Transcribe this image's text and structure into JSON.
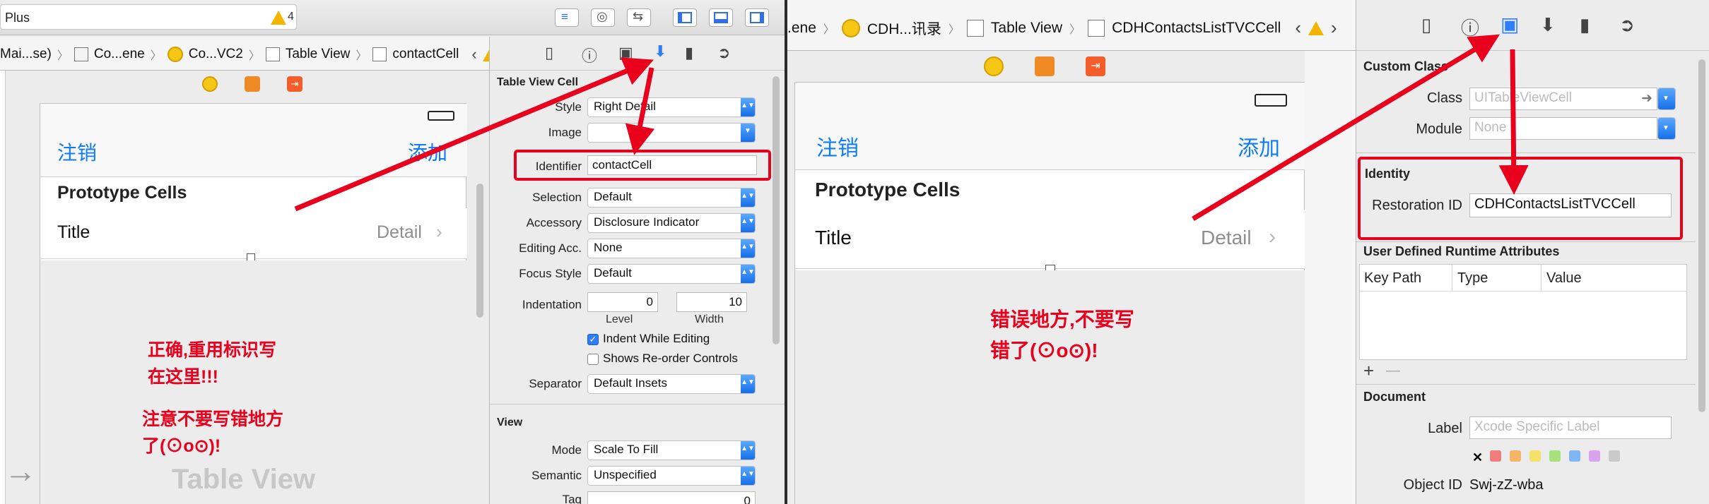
{
  "left": {
    "window": {
      "title_fragment": "Plus",
      "warning_count": "4"
    },
    "breadcrumb": {
      "items": [
        "Mai...se)",
        "Co...ene",
        "Co...VC2",
        "Table View",
        "contactCell"
      ]
    },
    "canvas": {
      "nav": {
        "left": "注销",
        "right": "添加"
      },
      "section": "Prototype Cells",
      "cell": {
        "title": "Title",
        "detail": "Detail"
      },
      "footer": "Table View",
      "note1": [
        "正确,重用标识写",
        "在这里!!!"
      ],
      "note2": [
        "注意不要写错地方",
        "了(⊙o⊙)!"
      ]
    },
    "inspector": {
      "section": "Table View Cell",
      "rows": [
        {
          "label": "Style",
          "value": "Right Detail"
        },
        {
          "label": "Image",
          "value": ""
        },
        {
          "label": "Identifier",
          "value": "contactCell"
        },
        {
          "label": "Selection",
          "value": "Default"
        },
        {
          "label": "Accessory",
          "value": "Disclosure Indicator"
        },
        {
          "label": "Editing Acc.",
          "value": "None"
        },
        {
          "label": "Focus Style",
          "value": "Default"
        }
      ],
      "indentation": {
        "label": "Indentation",
        "level": "0",
        "width": "10",
        "level_label": "Level",
        "width_label": "Width"
      },
      "indent_while_editing": "Indent While Editing",
      "show_reorder": "Shows Re-order Controls",
      "separator": {
        "label": "Separator",
        "value": "Default Insets"
      },
      "view_section": "View",
      "mode": {
        "label": "Mode",
        "value": "Scale To Fill"
      },
      "semantic": {
        "label": "Semantic",
        "value": "Unspecified"
      },
      "tag": {
        "label": "Tag",
        "value": "0"
      }
    }
  },
  "right": {
    "breadcrumb": {
      "items": [
        ".ene",
        "CDH...讯录",
        "Table View",
        "CDHContactsListTVCCell"
      ]
    },
    "canvas": {
      "nav": {
        "left": "注销",
        "right": "添加"
      },
      "section": "Prototype Cells",
      "cell": {
        "title": "Title",
        "detail": "Detail"
      },
      "note": [
        "错误地方,不要写",
        "错了(⊙o⊙)!"
      ]
    },
    "inspector": {
      "custom_class": "Custom Class",
      "class": {
        "label": "Class",
        "placeholder": "UITableViewCell"
      },
      "module": {
        "label": "Module",
        "placeholder": "None"
      },
      "identity": "Identity",
      "restoration": {
        "label": "Restoration ID",
        "value": "CDHContactsListTVCCell"
      },
      "udra": "User Defined Runtime Attributes",
      "columns": [
        "Key Path",
        "Type",
        "Value"
      ],
      "add": "+",
      "remove": "—",
      "document": "Document",
      "doc_label": {
        "label": "Label",
        "placeholder": "Xcode Specific Label"
      },
      "object_id": {
        "label": "Object ID",
        "value": "Swj-zZ-wba"
      },
      "colors": [
        "#f27d7d",
        "#f6b36a",
        "#f3e268",
        "#a6e07a",
        "#7fb6f5",
        "#d8a2ef",
        "#c9c9c9"
      ]
    }
  }
}
